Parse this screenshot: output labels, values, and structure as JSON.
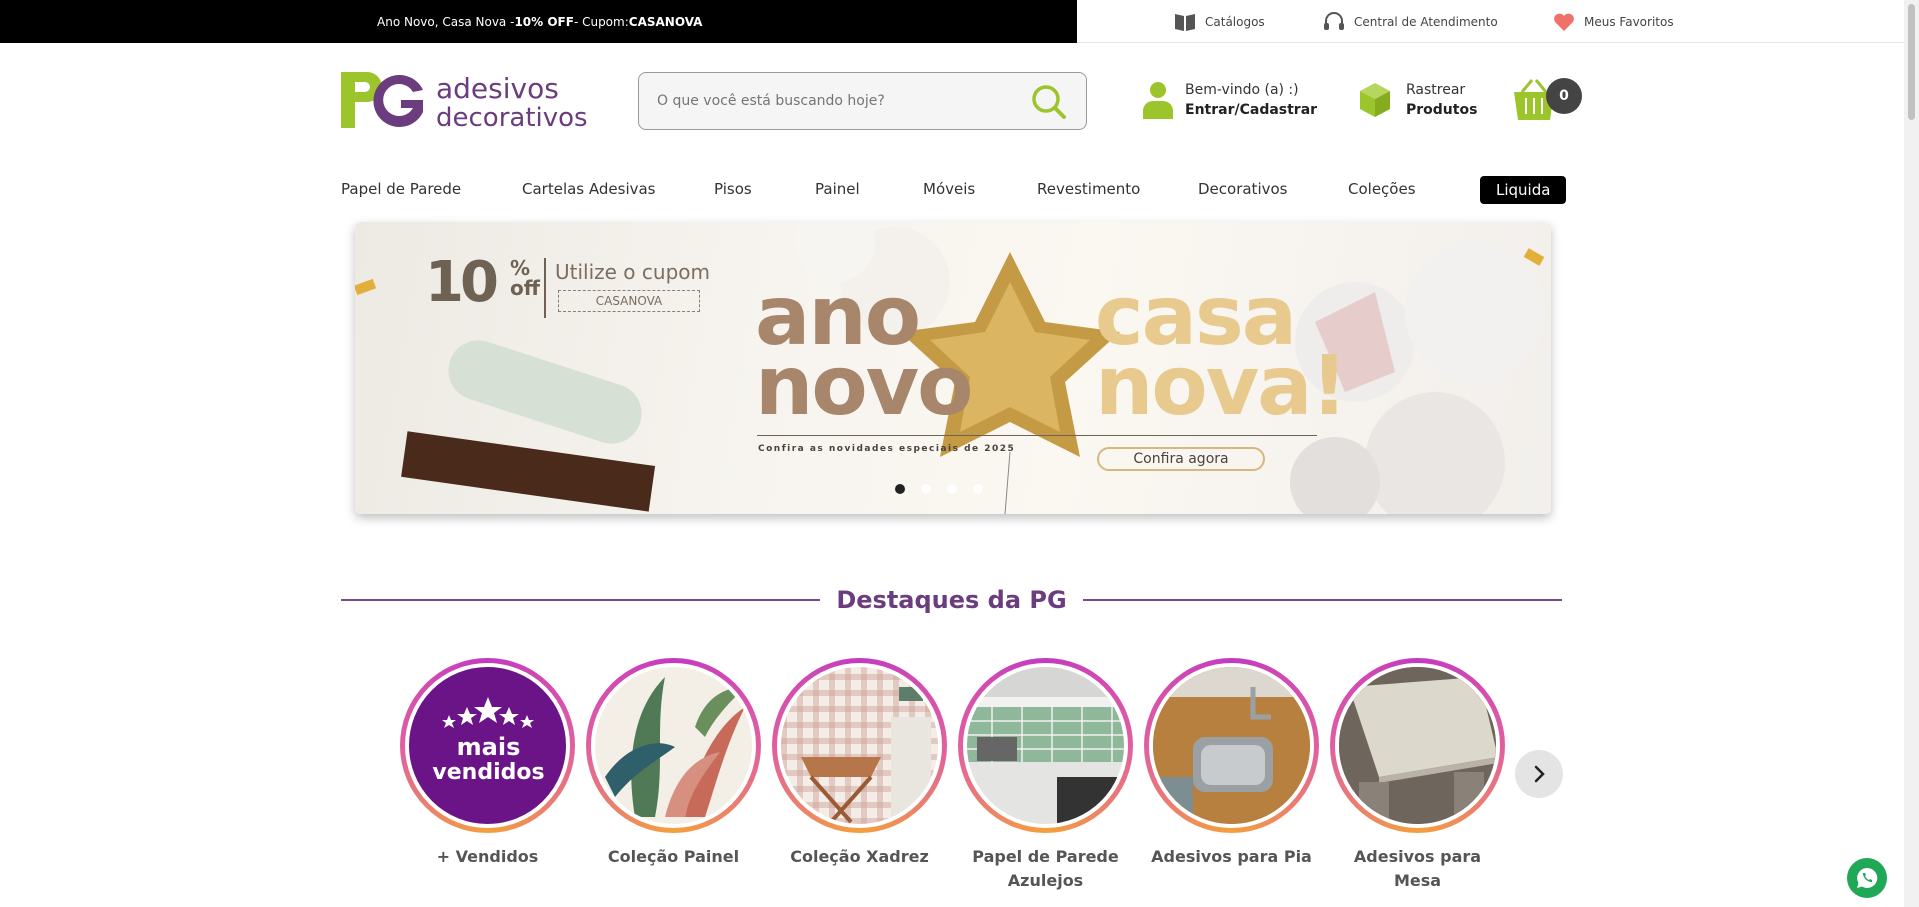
{
  "promo": {
    "prefix": "Ano Novo, Casa Nova - ",
    "discount": "10% OFF",
    "middle": " - Cupom: ",
    "code": "CASANOVA"
  },
  "toplinks": [
    {
      "label": "Catálogos",
      "icon": "book-icon"
    },
    {
      "label": "Central de Atendimento",
      "icon": "headset-icon"
    },
    {
      "label": "Meus Favoritos",
      "icon": "heart-icon"
    }
  ],
  "logo": {
    "initials": "PG",
    "line1": "adesivos",
    "line2": "decorativos"
  },
  "search": {
    "placeholder": "O que você está buscando hoje?"
  },
  "account": {
    "greeting": "Bem-vindo (a) :)",
    "action": "Entrar/Cadastrar"
  },
  "track": {
    "line1": "Rastrear",
    "line2": "Produtos"
  },
  "cart": {
    "count": "0"
  },
  "nav": [
    "Papel de Parede",
    "Cartelas Adesivas",
    "Pisos",
    "Painel",
    "Móveis",
    "Revestimento",
    "Decorativos",
    "Coleções",
    "Liquida"
  ],
  "banner": {
    "percent": "10",
    "off_a": "%",
    "off_b": "off",
    "use_coupon": "Utilize o cupom",
    "code": "CASANOVA",
    "word1a": "ano",
    "word1b": "novo",
    "word2a": "casa",
    "word2b": "nova!",
    "subtitle": "Confira as novidades especiais de 2025",
    "cta": "Confira agora",
    "slides": 4,
    "active_slide": 1
  },
  "highlights": {
    "title": "Destaques da PG",
    "items": [
      {
        "label": "+ Vendidos",
        "badge_top": "mais",
        "badge_bottom": "vendidos"
      },
      {
        "label": "Coleção Painel"
      },
      {
        "label": "Coleção Xadrez"
      },
      {
        "label": "Papel de Parede Azulejos"
      },
      {
        "label": "Adesivos para Pia"
      },
      {
        "label": "Adesivos para Mesa"
      }
    ]
  },
  "colors": {
    "brand_green": "#9cc42b",
    "brand_purple": "#6b3d7e",
    "ring_pink": "#c43ac1",
    "whatsapp": "#1fa855"
  }
}
